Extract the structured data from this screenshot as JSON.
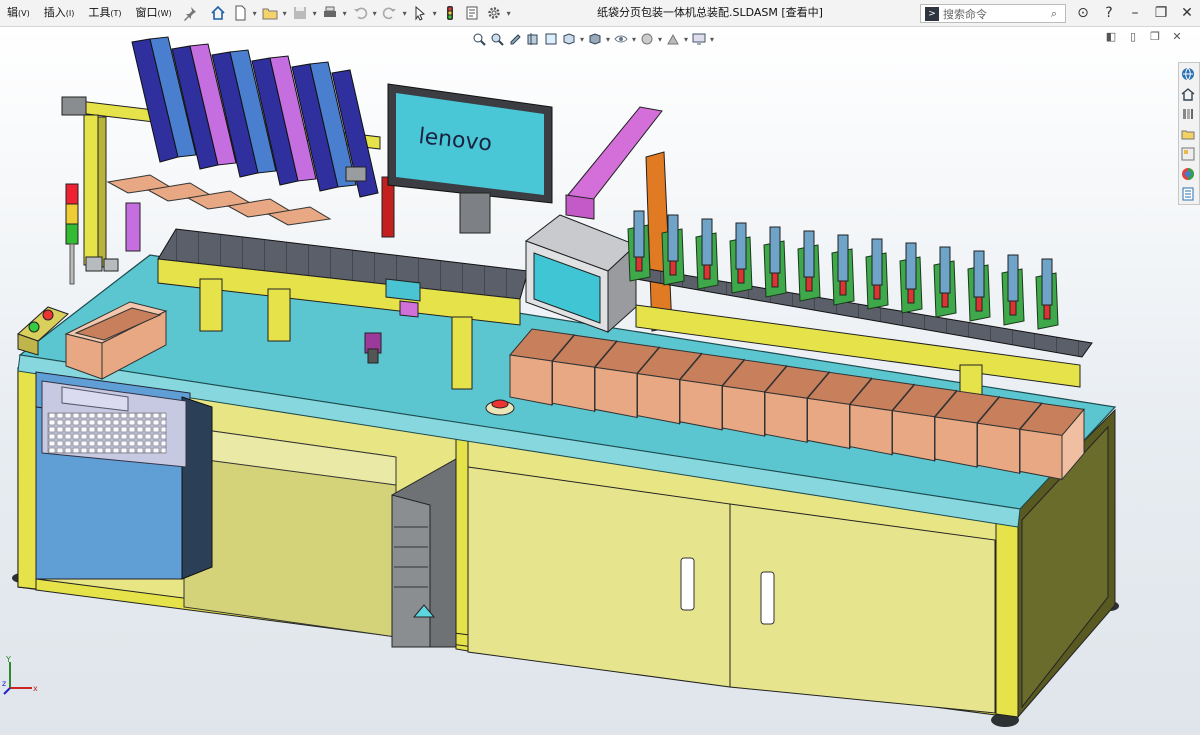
{
  "menu": [
    {
      "label": "辑",
      "shortcut": "(V)"
    },
    {
      "label": "插入",
      "shortcut": "(I)"
    },
    {
      "label": "工具",
      "shortcut": "(T)"
    },
    {
      "label": "窗口",
      "shortcut": "(W)"
    }
  ],
  "document": {
    "title": "纸袋分页包装一体机总装配.SLDASM [查看中]"
  },
  "search": {
    "placeholder": "搜索命令"
  },
  "screen_logo": "lenovo",
  "triad": {
    "x": "x",
    "y": "Y",
    "z": "z"
  },
  "colors": {
    "frame": "#e6e24a",
    "table": "#5bc6cf",
    "box": "#e7a883",
    "cabinet": "#ecec90",
    "conveyor": "#5b5f6a"
  }
}
